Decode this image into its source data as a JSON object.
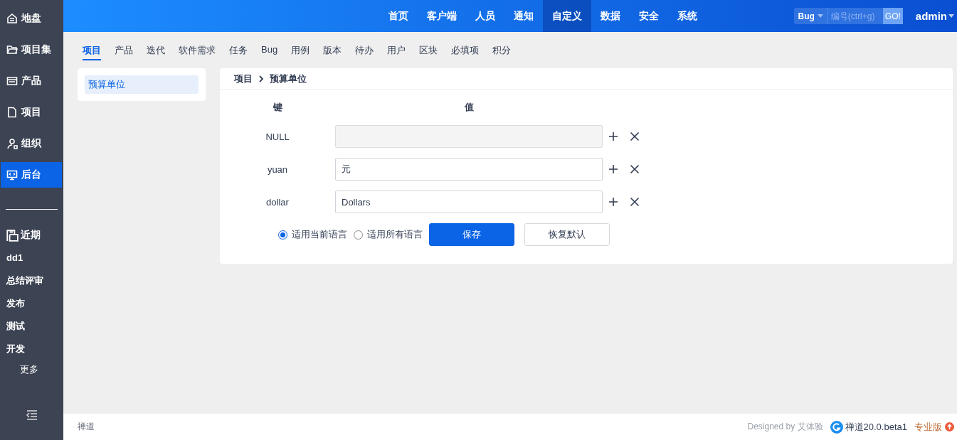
{
  "sidebar": {
    "items": [
      {
        "label": "地盘",
        "selected": false
      },
      {
        "label": "项目集",
        "selected": false
      },
      {
        "label": "产品",
        "selected": false
      },
      {
        "label": "项目",
        "selected": false
      },
      {
        "label": "组织",
        "selected": false
      },
      {
        "label": "后台",
        "selected": true
      }
    ],
    "recent": {
      "label": "近期",
      "items": [
        "dd1",
        "总结评审",
        "发布",
        "测试",
        "开发"
      ],
      "more": "更多"
    }
  },
  "topbar": {
    "nav": [
      {
        "label": "首页",
        "selected": false
      },
      {
        "label": "客户端",
        "selected": false
      },
      {
        "label": "人员",
        "selected": false
      },
      {
        "label": "通知",
        "selected": false
      },
      {
        "label": "自定义",
        "selected": true
      },
      {
        "label": "数据",
        "selected": false
      },
      {
        "label": "安全",
        "selected": false
      },
      {
        "label": "系统",
        "selected": false
      }
    ],
    "search": {
      "type": "Bug",
      "placeholder": "编号(ctrl+g)",
      "button": "GO!"
    },
    "user": "admin"
  },
  "tabs": [
    {
      "label": "项目",
      "selected": true
    },
    {
      "label": "产品",
      "selected": false
    },
    {
      "label": "迭代",
      "selected": false
    },
    {
      "label": "软件需求",
      "selected": false
    },
    {
      "label": "任务",
      "selected": false
    },
    {
      "label": "Bug",
      "selected": false
    },
    {
      "label": "用例",
      "selected": false
    },
    {
      "label": "版本",
      "selected": false
    },
    {
      "label": "待办",
      "selected": false
    },
    {
      "label": "用户",
      "selected": false
    },
    {
      "label": "区块",
      "selected": false
    },
    {
      "label": "必填项",
      "selected": false
    },
    {
      "label": "积分",
      "selected": false
    }
  ],
  "side_menu": [
    {
      "label": "预算单位",
      "selected": true
    }
  ],
  "breadcrumb": [
    "项目",
    "预算单位"
  ],
  "table": {
    "columns": [
      "键",
      "值"
    ],
    "rows": [
      {
        "key": "NULL",
        "disabled": true
      },
      {
        "key": "yuan",
        "value": "元",
        "disabled": false
      },
      {
        "key": "dollar",
        "value": "Dollars",
        "disabled": false
      }
    ]
  },
  "radios": [
    {
      "label": "适用当前语言",
      "selected": true
    },
    {
      "label": "适用所有语言",
      "selected": false
    }
  ],
  "buttons": {
    "save": "保存",
    "reset": "恢复默认"
  },
  "footer": {
    "brand": "禅道",
    "designed": "Designed by 艾体验",
    "version": "禅道20.0.beta1",
    "edition": "专业版"
  }
}
